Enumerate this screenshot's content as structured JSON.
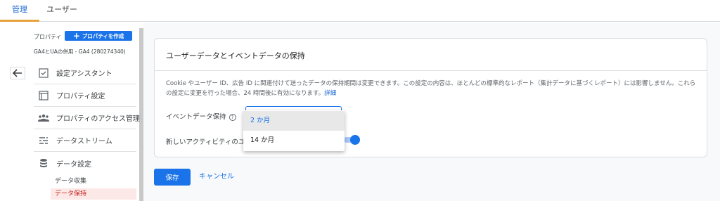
{
  "tabs": [
    {
      "label": "管理",
      "active": true
    },
    {
      "label": "ユーザー",
      "active": false
    }
  ],
  "sidebar": {
    "property_label": "プロパティ",
    "create_button": "プロパティを作成",
    "property_name": "GA4とUAの併用 - GA4 (280274340)",
    "items": [
      {
        "label": "設定アシスタント",
        "icon": "checklist-icon"
      },
      {
        "label": "プロパティ設定",
        "icon": "property-settings-icon"
      },
      {
        "label": "プロパティのアクセス管理",
        "icon": "people-icon"
      },
      {
        "label": "データストリーム",
        "icon": "data-stream-icon"
      },
      {
        "label": "データ設定",
        "icon": "database-icon"
      }
    ],
    "sub_items": [
      {
        "label": "データ収集",
        "active": false
      },
      {
        "label": "データ保持",
        "active": true
      }
    ]
  },
  "card": {
    "title": "ユーザーデータとイベントデータの保持",
    "description": "Cookie やユーザー ID、広告 ID に関連付けて送ったデータの保持期間は変更できます。この設定の内容は、ほとんどの標準的なレポート（集計データに基づくレポート）には影響しません。これらの設定に変更を行った場合、24 時間後に有効になります。",
    "details_link": "詳細",
    "event_retention_label": "イベントデータ保持",
    "new_activity_label": "新しいアクティビティのユ",
    "reset_toggle_on": true
  },
  "dropdown": {
    "options": [
      "2 か月",
      "14 か月"
    ],
    "selected_index": 0
  },
  "actions": {
    "save": "保存",
    "cancel": "キャンセル"
  },
  "colors": {
    "accent": "#1a73e8",
    "tab_indicator": "#e8a23c",
    "active_sub_bg": "#fce8e6"
  }
}
